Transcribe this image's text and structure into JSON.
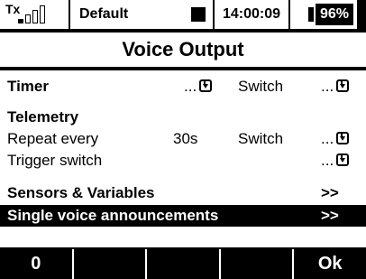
{
  "status": {
    "tx_label": "Tx",
    "signal_bars_filled": 1,
    "signal_bars_total": 4,
    "model_name": "Default",
    "time": "14:00:09",
    "battery": "96%"
  },
  "title": "Voice Output",
  "rows": {
    "timer": {
      "label": "Timer",
      "value1": "...",
      "label2": "Switch",
      "value2": "..."
    },
    "telemetry": {
      "label": "Telemetry"
    },
    "repeat": {
      "label": "Repeat every",
      "value": "30s",
      "label2": "Switch",
      "value2": "..."
    },
    "trigger": {
      "label": "Trigger switch",
      "value": "..."
    },
    "sensors": {
      "label": "Sensors & Variables",
      "arrow": ">>"
    },
    "single": {
      "label": "Single voice announcements",
      "arrow": ">>"
    }
  },
  "softkeys": [
    "0",
    "",
    "",
    "",
    "Ok"
  ]
}
